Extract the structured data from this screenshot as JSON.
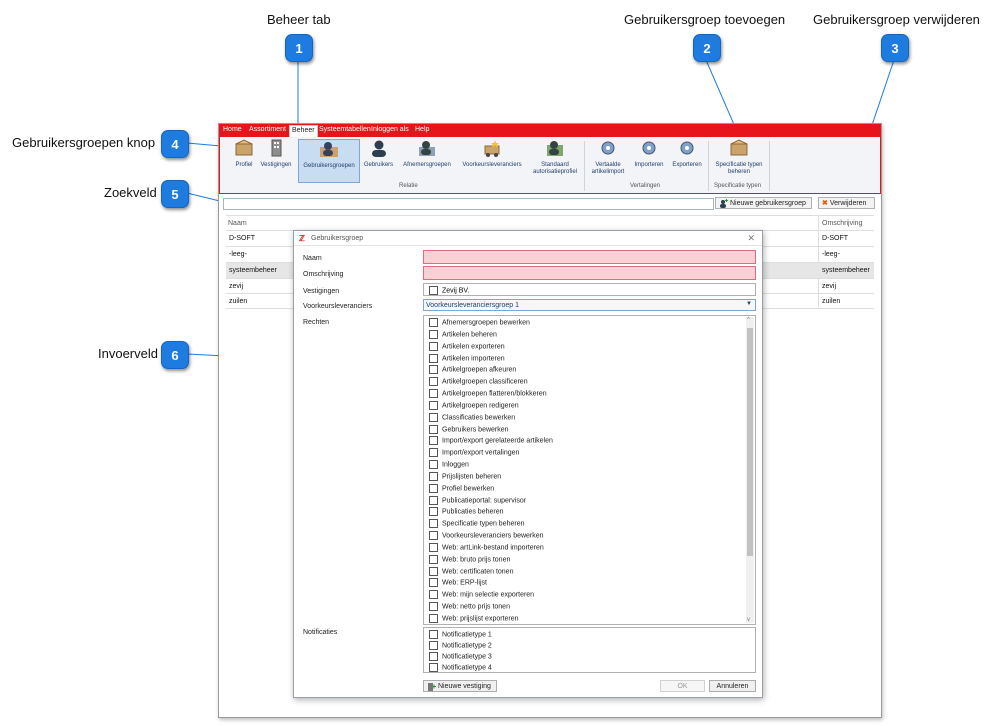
{
  "callouts": [
    {
      "num": "1",
      "text": "Beheer tab"
    },
    {
      "num": "2",
      "text": "Gebruikersgroep toevoegen"
    },
    {
      "num": "3",
      "text": "Gebruikersgroep verwijderen"
    },
    {
      "num": "4",
      "text": "Gebruikersgroepen knop"
    },
    {
      "num": "5",
      "text": "Zoekveld"
    },
    {
      "num": "6",
      "text": "Invoerveld"
    }
  ],
  "menu": {
    "items": [
      "Home",
      "Assortiment",
      "Beheer",
      "Systeemtabellen",
      "Inloggen als",
      "Help"
    ],
    "active": "Beheer"
  },
  "ribbon": {
    "buttons": [
      {
        "label": "Profiel"
      },
      {
        "label": "Vestigingen"
      },
      {
        "label": "Gebruikersgroepen"
      },
      {
        "label": "Gebruikers"
      },
      {
        "label": "Afnemersgroepen"
      },
      {
        "label": "Voorkeursleveranciers"
      },
      {
        "label": "Standaard autorisatieprofiel"
      },
      {
        "label": "Vertaalde artikelimport"
      },
      {
        "label": "Importeren"
      },
      {
        "label": "Exporteren"
      },
      {
        "label": "Specificatie typen beheren"
      }
    ],
    "groups": [
      "Relatie",
      "Vertalingen",
      "Specificatie typen"
    ]
  },
  "toolbar": {
    "new_group": "Nieuwe gebruikersgroep",
    "delete": "Verwijderen",
    "search_value": ""
  },
  "grid": {
    "col_name": "Naam",
    "col_desc": "Omschrijving",
    "rows": [
      {
        "name": "D-SOFT",
        "desc": "D-SOFT"
      },
      {
        "name": "-leeg-",
        "desc": "-leeg-"
      },
      {
        "name": "systeembeheer",
        "desc": "systeembeheer"
      },
      {
        "name": "zevij",
        "desc": "zevij"
      },
      {
        "name": "zuilen",
        "desc": "zuilen"
      }
    ]
  },
  "dialog": {
    "title": "Gebruikersgroep",
    "close": "✕",
    "labels": {
      "naam": "Naam",
      "omschrijving": "Omschrijving",
      "vestigingen": "Vestigingen",
      "voorkeur": "Voorkeursleveranciers",
      "rechten": "Rechten",
      "notificaties": "Notificaties"
    },
    "naam_value": "",
    "omschrijving_value": "",
    "vestiging_option": "Zevij BV.",
    "voorkeur_selected": "Voorkeursleveranciersgroep 1",
    "rechten": [
      "Afnemersgroepen bewerken",
      "Artikelen beheren",
      "Artikelen exporteren",
      "Artikelen importeren",
      "Artikelgroepen afkeuren",
      "Artikelgroepen classificeren",
      "Artikelgroepen flatteren/blokkeren",
      "Artikelgroepen redigeren",
      "Classificaties bewerken",
      "Gebruikers bewerken",
      "Import/export gerelateerde artikelen",
      "Import/export vertalingen",
      "Inloggen",
      "Prijslijsten beheren",
      "Profiel bewerken",
      "Publicatieportal: supervisor",
      "Publicaties beheren",
      "Specificatie typen beheren",
      "Voorkeursleveranciers bewerken",
      "Web: artLink-bestand importeren",
      "Web: bruto prijs tonen",
      "Web: certificaten tonen",
      "Web: ERP-lijst",
      "Web: mijn selectie exporteren",
      "Web: netto prijs tonen",
      "Web: prijslijst exporteren"
    ],
    "notificaties": [
      "Notificatietype 1",
      "Notificatietype 2",
      "Notificatietype 3",
      "Notificatietype 4"
    ],
    "new_vestiging": "Nieuwe vestiging",
    "ok": "OK",
    "cancel": "Annuleren"
  },
  "colors": {
    "accent_red": "#e8141b",
    "badge_blue": "#1e7be0",
    "error_field": "#fcd1d6"
  }
}
